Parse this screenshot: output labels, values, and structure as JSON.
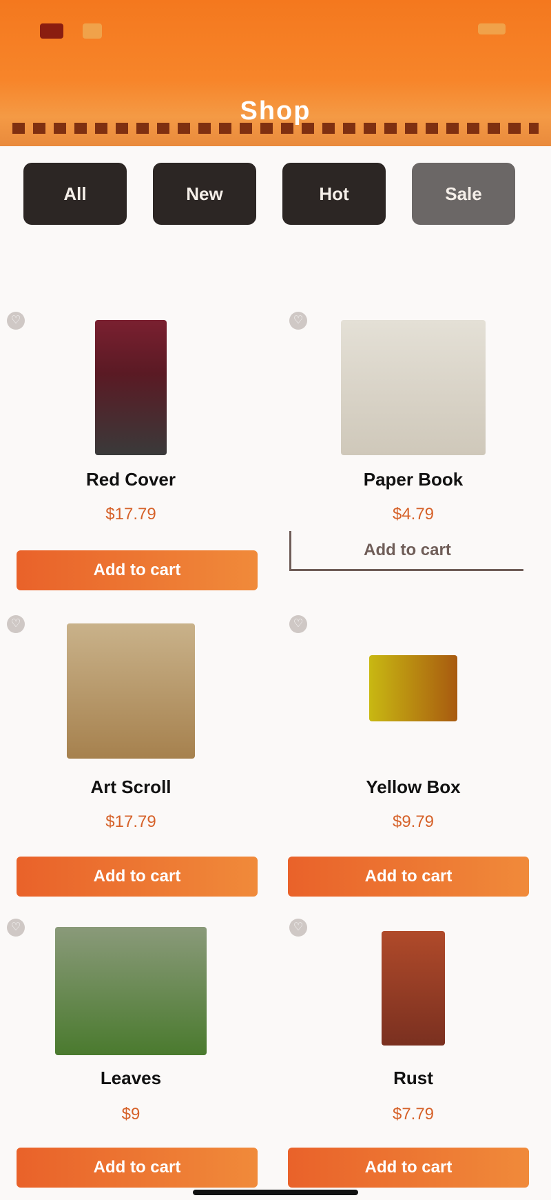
{
  "status": {
    "left_icon": "record-icon",
    "right_icon": "battery-icon"
  },
  "header": {
    "title": "Shop"
  },
  "categories": [
    {
      "label": "All"
    },
    {
      "label": "New"
    },
    {
      "label": "Hot"
    },
    {
      "label": "Sale"
    }
  ],
  "products": [
    {
      "title": "Red Cover",
      "price": "$17.79",
      "button": "Add to cart",
      "cover_color": "#7a2030"
    },
    {
      "title": "Paper Book",
      "price": "$4.79",
      "button": "Add to cart",
      "cover_color": "#d9d3c7"
    },
    {
      "title": "Art Scroll",
      "price": "$17.79",
      "button": "Add to cart",
      "cover_color": "#b08a5a"
    },
    {
      "title": "Yellow Box",
      "price": "$9.79",
      "button": "Add to cart",
      "cover_color": "#c8b812"
    },
    {
      "title": "Leaves",
      "price": "$9",
      "button": "Add to cart",
      "cover_color": "#4a7a2e"
    },
    {
      "title": "Rust",
      "price": "$7.79",
      "button": "Add to cart",
      "cover_color": "#b04a2a"
    }
  ],
  "colors": {
    "accent": "#f4781e",
    "button": "#e9622a",
    "price": "#d6622a"
  }
}
